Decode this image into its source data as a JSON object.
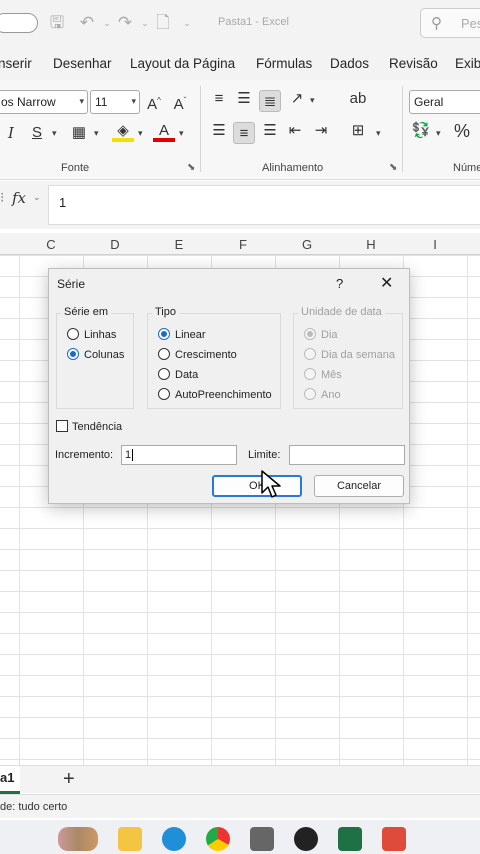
{
  "titlebar": {
    "title": "Pasta1  -  Excel",
    "search_placeholder": "Pes"
  },
  "menu": {
    "tabs": [
      "nserir",
      "Desenhar",
      "Layout da Página",
      "Fórmulas",
      "Dados",
      "Revisão",
      "Exib"
    ]
  },
  "ribbon": {
    "font_name": "os Narrow",
    "font_size": "11",
    "number_format": "Geral",
    "group_font": "Fonte",
    "group_alignment": "Alinhamento",
    "group_number": "Núme",
    "italic": "I",
    "strike": "S",
    "percent": "%"
  },
  "formula_bar": {
    "fx": "fx",
    "value": "1"
  },
  "columns": [
    "C",
    "D",
    "E",
    "F",
    "G",
    "H",
    "I"
  ],
  "dialog": {
    "title": "Série",
    "help": "?",
    "close": "✕",
    "serie_em": {
      "legend": "Série em",
      "options": [
        "Linhas",
        "Colunas"
      ],
      "selected": "Colunas"
    },
    "tipo": {
      "legend": "Tipo",
      "options": [
        "Linear",
        "Crescimento",
        "Data",
        "AutoPreenchimento"
      ],
      "selected": "Linear"
    },
    "unidade": {
      "legend": "Unidade de data",
      "options": [
        "Dia",
        "Dia da semana",
        "Mês",
        "Ano"
      ],
      "selected": "Dia"
    },
    "tendencia": "Tendência",
    "incremento_label": "Incremento:",
    "incremento_value": "1",
    "limite_label": "Limite:",
    "limite_value": "",
    "ok": "OK",
    "cancel": "Cancelar"
  },
  "sheet": {
    "tab": "a1",
    "add": "+"
  },
  "status": {
    "text": "de: tudo certo"
  }
}
